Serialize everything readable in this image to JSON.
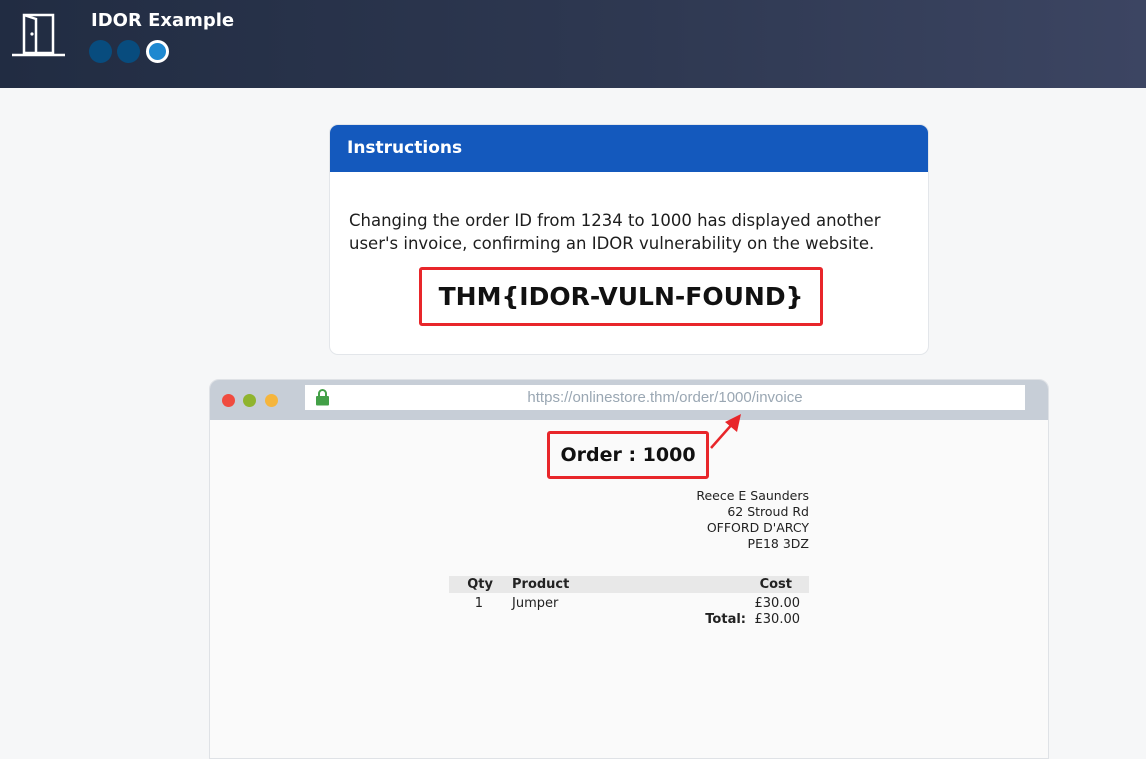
{
  "header": {
    "title": "IDOR Example",
    "progress_steps": [
      {
        "state": "done"
      },
      {
        "state": "done"
      },
      {
        "state": "current"
      }
    ],
    "icon": "door-icon"
  },
  "instructions": {
    "title": "Instructions",
    "body": "Changing the order ID from 1234 to 1000 has displayed another user's invoice, confirming an IDOR vulnerability on the website.",
    "flag": "THM{IDOR-VULN-FOUND}"
  },
  "browser": {
    "url": "https://onlinestore.thm/order/1000/invoice",
    "traffic_lights": [
      "#f04b3f",
      "#8fb42e",
      "#f5b53c"
    ],
    "lock_color": "#43a047"
  },
  "invoice": {
    "order_label": "Order : 1000",
    "address": [
      "Reece E Saunders",
      "62 Stroud Rd",
      "OFFORD D'ARCY",
      "PE18 3DZ"
    ],
    "columns": {
      "qty": "Qty",
      "product": "Product",
      "cost": "Cost"
    },
    "rows": [
      {
        "qty": "1",
        "product": "Jumper",
        "cost": "£30.00"
      }
    ],
    "total_label": "Total:",
    "total_value": "£30.00"
  },
  "colors": {
    "accent_blue": "#1459bd",
    "highlight_red": "#e8262a"
  }
}
